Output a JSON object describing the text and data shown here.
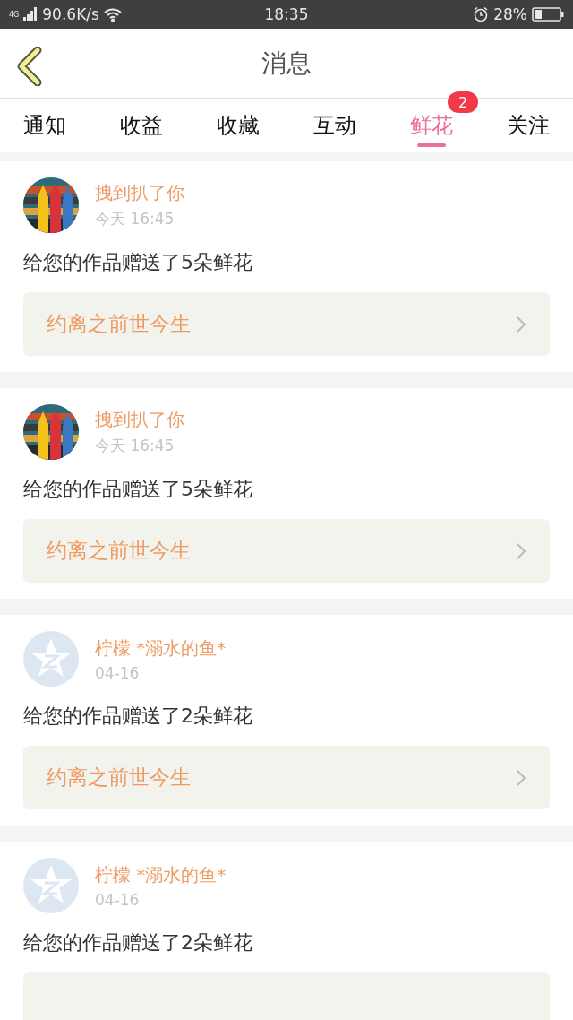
{
  "status_bar": {
    "network": "4G",
    "speed": "90.6K/s",
    "time": "18:35",
    "battery": "28%"
  },
  "header": {
    "title": "消息"
  },
  "tabs": [
    {
      "label": "通知",
      "selected": false
    },
    {
      "label": "收益",
      "selected": false
    },
    {
      "label": "收藏",
      "selected": false
    },
    {
      "label": "互动",
      "selected": false
    },
    {
      "label": "鲜花",
      "selected": true,
      "badge": "2"
    },
    {
      "label": "关注",
      "selected": false
    }
  ],
  "messages": [
    {
      "kind": "picture",
      "user": "拽到扒了你",
      "time": "今天 16:45",
      "text": "给您的作品赠送了5朵鲜花",
      "work": "约离之前世今生"
    },
    {
      "kind": "picture",
      "user": "拽到扒了你",
      "time": "今天 16:45",
      "text": "给您的作品赠送了5朵鲜花",
      "work": "约离之前世今生"
    },
    {
      "kind": "default",
      "user": "柠檬 *溺水的鱼*",
      "time": "04-16",
      "text": "给您的作品赠送了2朵鲜花",
      "work": "约离之前世今生"
    },
    {
      "kind": "default",
      "user": "柠檬 *溺水的鱼*",
      "time": "04-16",
      "text": "给您的作品赠送了2朵鲜花"
    }
  ]
}
